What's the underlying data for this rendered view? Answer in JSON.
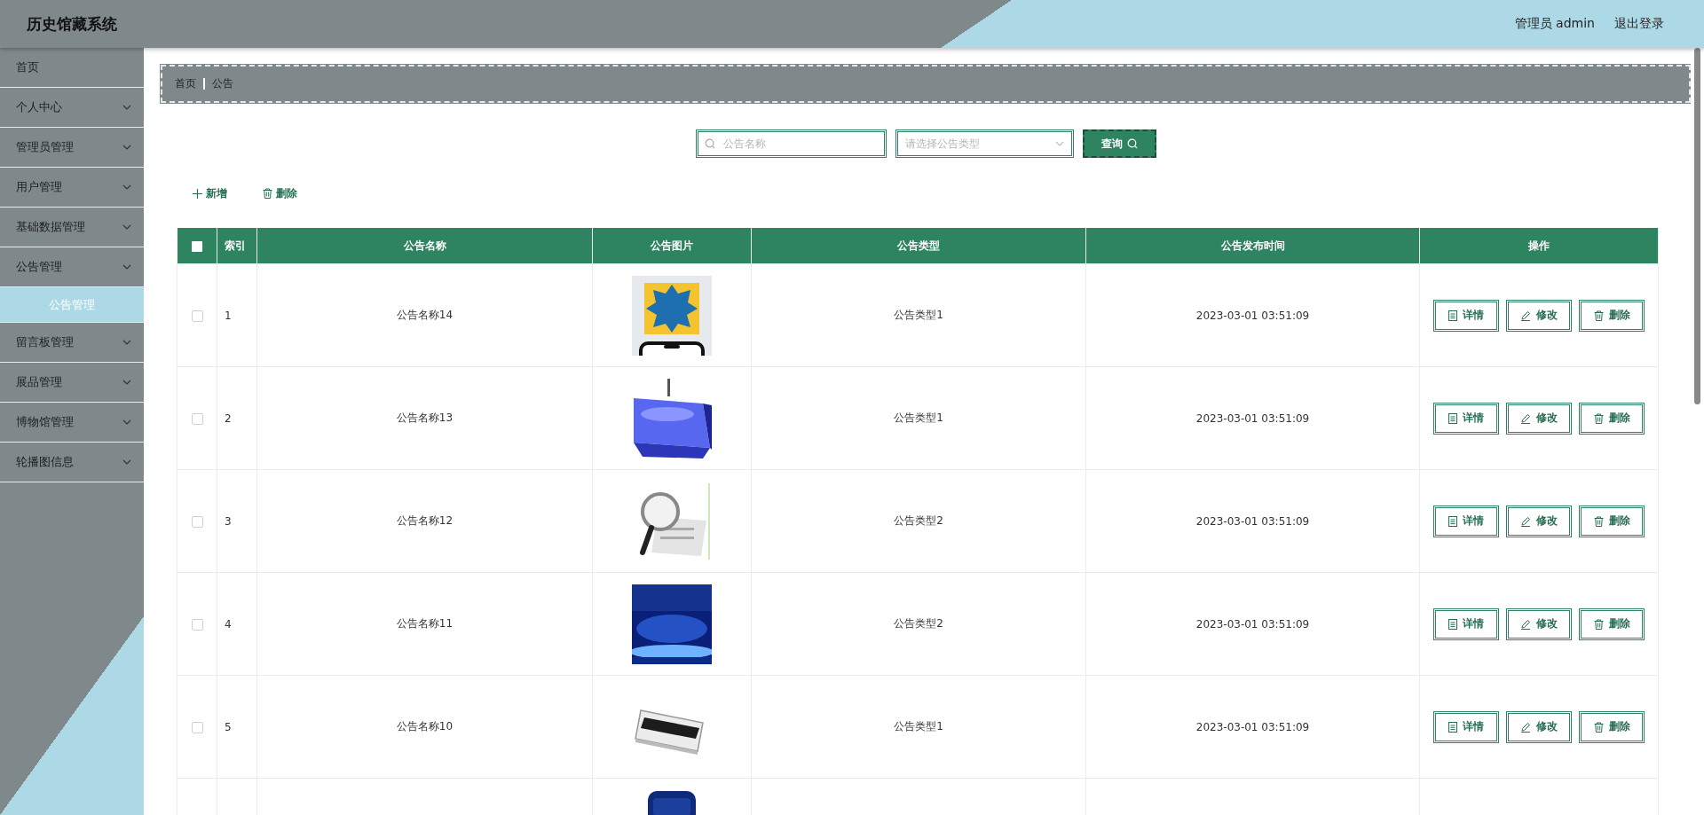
{
  "app": {
    "title": "历史馆藏系统"
  },
  "header": {
    "user": "管理员 admin",
    "logout": "退出登录"
  },
  "sidebar": {
    "items": [
      {
        "label": "首页",
        "kind": "link"
      },
      {
        "label": "个人中心",
        "kind": "menu"
      },
      {
        "label": "管理员管理",
        "kind": "menu"
      },
      {
        "label": "用户管理",
        "kind": "menu"
      },
      {
        "label": "基础数据管理",
        "kind": "menu"
      },
      {
        "label": "公告管理",
        "kind": "menu",
        "children": [
          {
            "label": "公告管理",
            "selected": true
          }
        ]
      },
      {
        "label": "留言板管理",
        "kind": "menu"
      },
      {
        "label": "展品管理",
        "kind": "menu"
      },
      {
        "label": "博物馆管理",
        "kind": "menu"
      },
      {
        "label": "轮播图信息",
        "kind": "menu"
      }
    ]
  },
  "breadcrumb": [
    "首页",
    "公告"
  ],
  "search": {
    "name_field": {
      "placeholder": "公告名称"
    },
    "type_select": {
      "placeholder": "请选择公告类型"
    },
    "button": "查询"
  },
  "toolbar": [
    {
      "kind": "add",
      "label": "新增"
    },
    {
      "kind": "delete",
      "label": "删除"
    }
  ],
  "table": {
    "select_all": {
      "checked": false
    },
    "columns": [
      "索引",
      "公告名称",
      "公告图片",
      "公告类型",
      "公告发布时间",
      "操作"
    ],
    "rows": [
      {
        "checked": false,
        "index": "1",
        "name": "公告名称14",
        "type": "公告类型1",
        "time": "2023-03-01 03:51:09",
        "actions": [
          {
            "kind": "detail",
            "label": "详情"
          },
          {
            "kind": "edit",
            "label": "修改"
          },
          {
            "kind": "delete",
            "label": "删除"
          }
        ]
      },
      {
        "checked": false,
        "index": "2",
        "name": "公告名称13",
        "type": "公告类型1",
        "time": "2023-03-01 03:51:09",
        "actions": [
          {
            "kind": "detail",
            "label": "详情"
          },
          {
            "kind": "edit",
            "label": "修改"
          },
          {
            "kind": "delete",
            "label": "删除"
          }
        ]
      },
      {
        "checked": false,
        "index": "3",
        "name": "公告名称12",
        "type": "公告类型2",
        "time": "2023-03-01 03:51:09",
        "actions": [
          {
            "kind": "detail",
            "label": "详情"
          },
          {
            "kind": "edit",
            "label": "修改"
          },
          {
            "kind": "delete",
            "label": "删除"
          }
        ]
      },
      {
        "checked": false,
        "index": "4",
        "name": "公告名称11",
        "type": "公告类型2",
        "time": "2023-03-01 03:51:09",
        "actions": [
          {
            "kind": "detail",
            "label": "详情"
          },
          {
            "kind": "edit",
            "label": "修改"
          },
          {
            "kind": "delete",
            "label": "删除"
          }
        ]
      },
      {
        "checked": false,
        "index": "5",
        "name": "公告名称10",
        "type": "公告类型1",
        "time": "2023-03-01 03:51:09",
        "actions": [
          {
            "kind": "detail",
            "label": "详情"
          },
          {
            "kind": "edit",
            "label": "修改"
          },
          {
            "kind": "delete",
            "label": "删除"
          }
        ]
      }
    ]
  }
}
